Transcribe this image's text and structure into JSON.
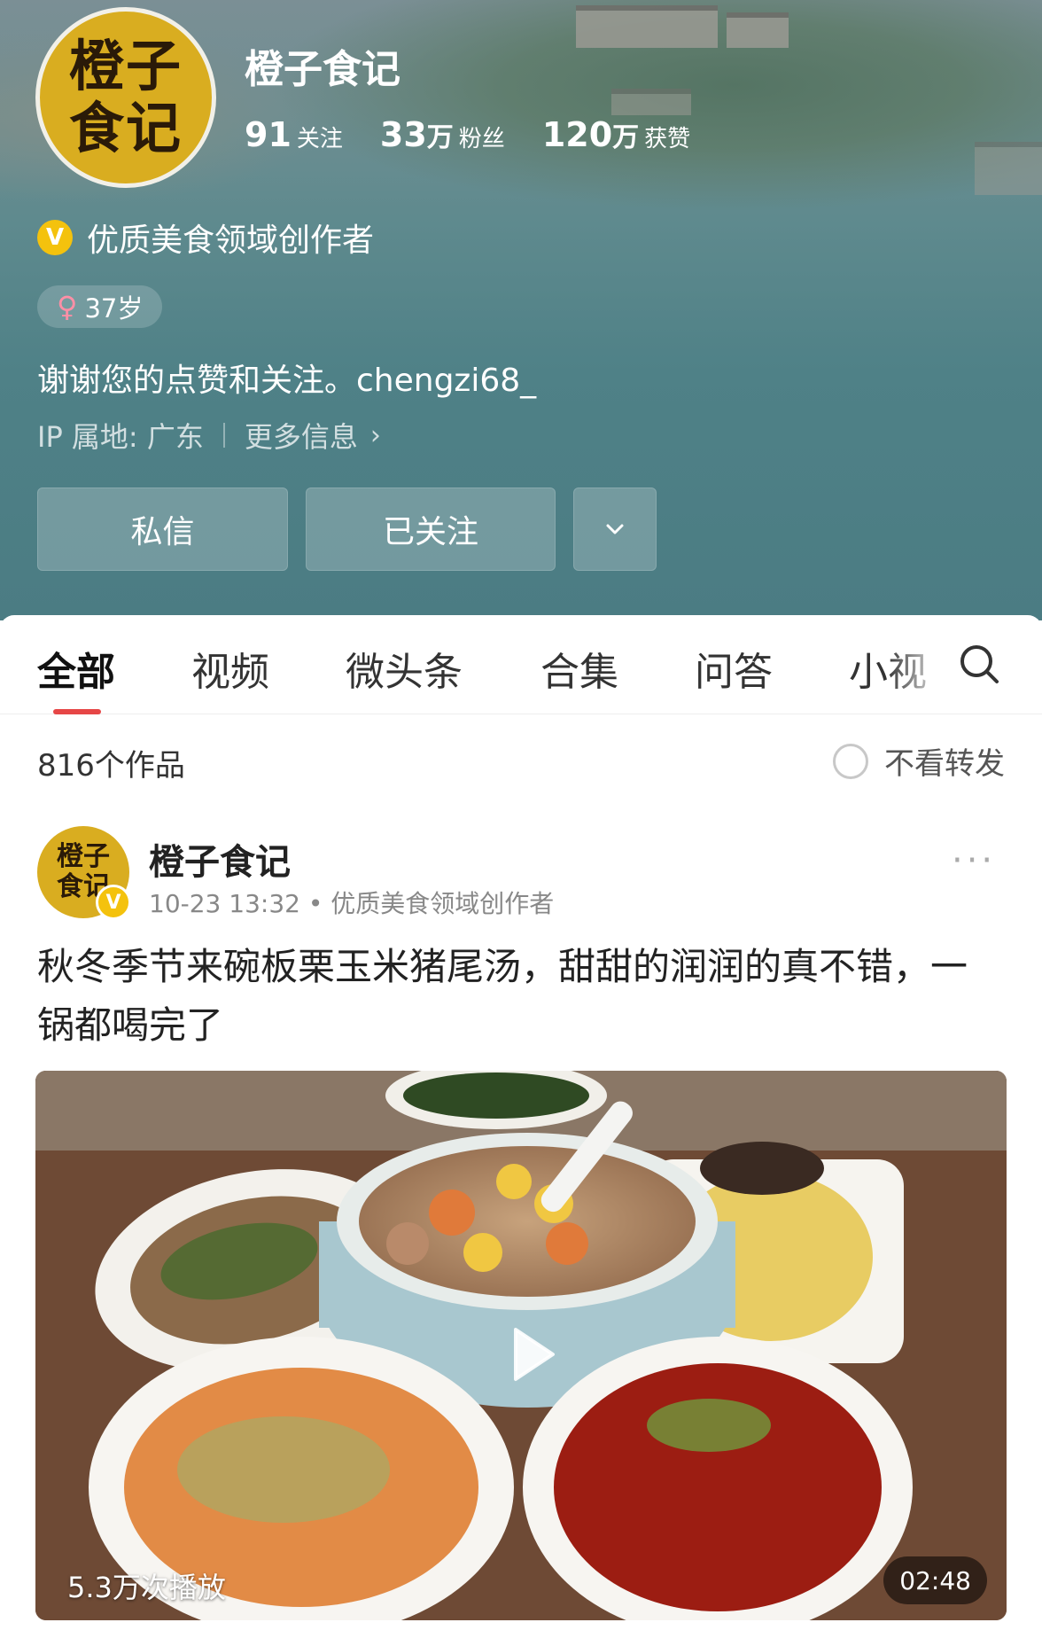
{
  "profile": {
    "avatar_line1": "橙子",
    "avatar_line2": "食记",
    "name": "橙子食记",
    "stats": [
      {
        "num": "91",
        "unit": "",
        "label": "关注"
      },
      {
        "num": "33",
        "unit": "万",
        "label": "粉丝"
      },
      {
        "num": "120",
        "unit": "万",
        "label": "获赞"
      }
    ],
    "verified_badge": "V",
    "verified_text": "优质美食领域创作者",
    "gender_symbol": "♀",
    "age": "37岁",
    "bio": "谢谢您的点赞和关注。chengzi68_",
    "ip": "IP 属地: 广东",
    "more_info": "更多信息",
    "buttons": {
      "message": "私信",
      "follow": "已关注"
    }
  },
  "tabs": [
    {
      "label": "全部",
      "active": true
    },
    {
      "label": "视频"
    },
    {
      "label": "微头条"
    },
    {
      "label": "合集"
    },
    {
      "label": "问答"
    },
    {
      "label": "小视"
    }
  ],
  "works_count": "816个作品",
  "no_repost": "不看转发",
  "post": {
    "avatar_line1": "橙子",
    "avatar_line2": "食记",
    "badge": "V",
    "author": "橙子食记",
    "meta": "10-23 13:32 • 优质美食领域创作者",
    "more": "···",
    "title": "秋冬季节来碗板栗玉米猪尾汤，甜甜的润润的真不错，一锅都喝完了",
    "views": "5.3万次播放",
    "duration": "02:48"
  },
  "colors": {
    "header_bg": "#5a868b",
    "accent_red": "#e64646",
    "badge_yellow": "#f4c20d",
    "avatar_gold": "#d9ad20"
  },
  "icons": [
    "search-icon",
    "chevron-down-icon",
    "chevron-right-icon",
    "play-icon",
    "female-icon",
    "more-icon"
  ]
}
